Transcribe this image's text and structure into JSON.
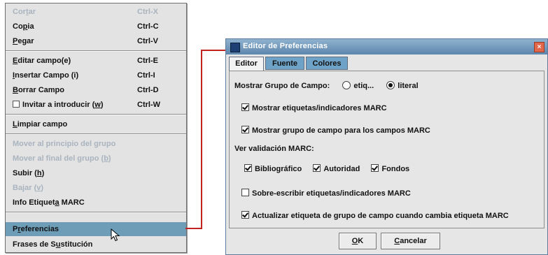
{
  "menu": {
    "items": [
      {
        "pre": "Cor",
        "u": "t",
        "post": "ar",
        "shortcut": "Ctrl-X",
        "state": "disabled"
      },
      {
        "pre": "Co",
        "u": "p",
        "post": "ia",
        "shortcut": "Ctrl-C",
        "state": "normal"
      },
      {
        "pre": "",
        "u": "P",
        "post": "egar",
        "shortcut": "Ctrl-V",
        "state": "normal"
      },
      {
        "pre": "",
        "u": "E",
        "post": "ditar campo(e)",
        "shortcut": "Ctrl-E",
        "state": "normal"
      },
      {
        "pre": "",
        "u": "I",
        "post": "nsertar Campo (i)",
        "shortcut": "Ctrl-I",
        "state": "normal"
      },
      {
        "pre": "",
        "u": "B",
        "post": "orrar Campo",
        "shortcut": "Ctrl-D",
        "state": "normal"
      },
      {
        "pre": "Invitar a introducir (",
        "u": "w",
        "post": ")",
        "shortcut": "Ctrl-W",
        "state": "normal",
        "checkbox": true
      },
      {
        "pre": "",
        "u": "L",
        "post": "impiar campo",
        "shortcut": "",
        "state": "normal"
      },
      {
        "pre": "Mover al principio del grupo",
        "u": "",
        "post": "",
        "shortcut": "",
        "state": "disabled"
      },
      {
        "pre": "Mover al final del grupo (",
        "u": "b",
        "post": ")",
        "shortcut": "",
        "state": "disabled"
      },
      {
        "pre": "Subir (",
        "u": "h",
        "post": ")",
        "shortcut": "",
        "state": "normal"
      },
      {
        "pre": "Bajar (",
        "u": "v",
        "post": ")",
        "shortcut": "",
        "state": "disabled"
      },
      {
        "pre": "Info Etiquet",
        "u": "a",
        "post": " MARC",
        "shortcut": "",
        "state": "normal"
      },
      {
        "pre": "P",
        "u": "r",
        "post": "eferencias",
        "shortcut": "",
        "state": "selected"
      },
      {
        "pre": "Frases de S",
        "u": "u",
        "post": "stitución",
        "shortcut": "",
        "state": "normal"
      }
    ]
  },
  "dialog": {
    "title": "Editor de Preferencias",
    "close_glyph": "×",
    "tabs": [
      {
        "label": "Editor",
        "active": true
      },
      {
        "label": "Fuente",
        "active": false
      },
      {
        "label": "Colores",
        "active": false
      }
    ],
    "group_label": "Mostrar Grupo de Campo:",
    "radio_options": [
      {
        "label": "etiq...",
        "selected": false
      },
      {
        "label": "literal",
        "selected": true
      }
    ],
    "cb_show_tags": {
      "label": "Mostrar etiquetas/indicadores MARC",
      "checked": true
    },
    "cb_show_group": {
      "label": "Mostrar grupo de campo para los campos MARC",
      "checked": true
    },
    "validation_label": "Ver validación MARC:",
    "validation_options": [
      {
        "label": "Bibliográfico",
        "checked": true
      },
      {
        "label": "Autoridad",
        "checked": true
      },
      {
        "label": "Fondos",
        "checked": true
      }
    ],
    "cb_overwrite": {
      "label": "Sobre-escribir etiquetas/indicadores MARC",
      "checked": false
    },
    "cb_update": {
      "label": "Actualizar etiqueta de grupo de campo cuando cambia etiqueta MARC",
      "checked": true
    },
    "ok": {
      "u": "O",
      "post": "K"
    },
    "cancel": {
      "u": "C",
      "post": "ancelar"
    }
  },
  "colors": {
    "connector": "#c32222",
    "selected_row": "#6e9db8",
    "inactive_tab": "#6fa2c7",
    "disabled_text": "#a9b4bf"
  }
}
